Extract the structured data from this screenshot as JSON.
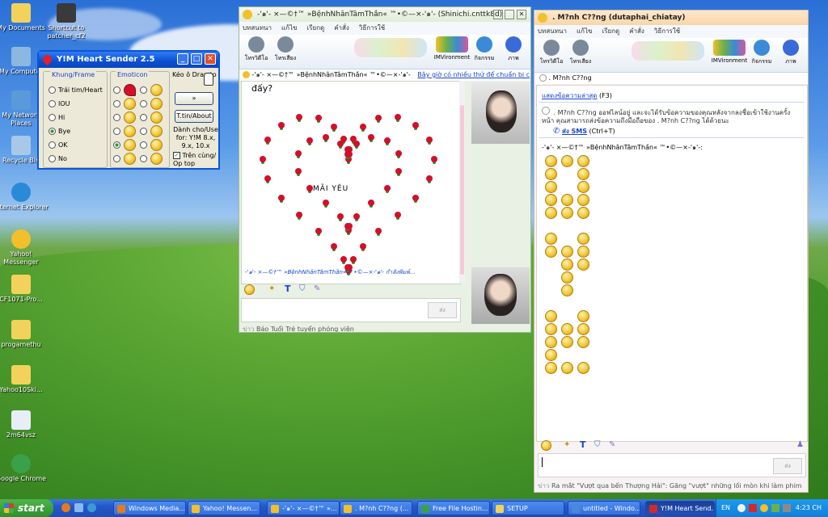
{
  "desktop": {
    "icons": [
      {
        "label": "My Documents",
        "icon": "folder-icon"
      },
      {
        "label": "Shortcut to patcher_cf2",
        "icon": "app-shortcut-icon"
      },
      {
        "label": "My Computer",
        "icon": "computer-icon"
      },
      {
        "label": "My Network Places",
        "icon": "network-icon"
      },
      {
        "label": "Recycle Bin",
        "icon": "recycle-bin-icon"
      },
      {
        "label": "Internet Explorer",
        "icon": "internet-explorer-icon"
      },
      {
        "label": "Yahoo! Messenger",
        "icon": "yahoo-messenger-icon"
      },
      {
        "label": "CF1071-Pro...",
        "icon": "folder-icon"
      },
      {
        "label": "progamethu",
        "icon": "folder-icon"
      },
      {
        "label": "Yahoo10Ski...",
        "icon": "folder-icon"
      },
      {
        "label": "2m64vsz",
        "icon": "file-icon"
      },
      {
        "label": "Google Chrome",
        "icon": "chrome-icon"
      }
    ]
  },
  "heart_sender": {
    "title": "Y!M Heart Sender 2.5",
    "frame_group": "Khung/Frame",
    "frame_options": [
      "Trái tim/Heart",
      "IOU",
      "Hi",
      "Bye",
      "OK",
      "No"
    ],
    "frame_selected": "Bye",
    "emoticon_group": "Emoticon",
    "drag_hint": "Kéo ô Drap to",
    "send_button": "»",
    "about_button": "T.tin/About",
    "compat_text": "Dành cho/Use for: Y!M 8.x, 9.x, 10.x",
    "ontop_label": "Trên cùng/ Op top",
    "ontop_checked": true
  },
  "chat1": {
    "title": "-'๑'- ×—©†™ »BệnhNhânTâmThần« ™•©—×-'๑'- (Shinichi.cnttk8d)",
    "menu": [
      "บทสนทนา",
      "แก้ไข",
      "เรียกดู",
      "คำสั่ง",
      "วิธีการใช้"
    ],
    "toolbar": [
      "โทรวิดีโอ",
      "โทรเสียง",
      "IMVironment",
      "กิจกรรม",
      "ภาพ"
    ],
    "header_name": "-'๑'- ×—©†™ »BệnhNhânTâmThần« ™•©—×-'๑'-",
    "header_status": "Bây giờ có nhiều thứ để chuẩn bị c",
    "first_line": "đấy?",
    "heart_text": "MÃI  YÊU",
    "typing_line": "-'๑'- ×—©†™ »BệnhNhânTâmThần« ™•©—×-'๑'- กำลังพิมพ์...",
    "send_label": "ส่ง",
    "footer": "Báo Tuổi Trẻ tuyển phóng viên"
  },
  "chat2": {
    "title": ". M?nh C??ng (dutaphai_chiatay)",
    "menu": [
      "บทสนทนา",
      "แก้ไข",
      "เรียกดู",
      "คำสั่ง",
      "วิธีการใช้"
    ],
    "toolbar": [
      "โทรวิดีโอ",
      "โทรเสียง",
      "IMVironment",
      "กิจกรรม",
      "ภาพ"
    ],
    "contact_name": ". M?nh C??ng",
    "show_recent": "แสดงข้อความล่าสุด",
    "show_recent_key": "(F3)",
    "notice": ". M?nh C??ng ออฟไลน์อยู่ และจะได้รับข้อความของคุณหลังจากลงชื่อเข้าใช้งานครั้งหน้า คุณสามารถส่งข้อความถึงมือถือของ . M?nh C??ng ได้ด้วยนะ",
    "sms_link": "ส่ง SMS",
    "sms_key": "(Ctrl+T)",
    "sender_line": "-'๑'- ×—©†™ »BệnhNhânTâmThần« ™•©—×-'๑'-:",
    "send_label": "ส่ง",
    "footer": "Ra mắt \"Vượt qua bến Thượng Hải\": Găng \"vượt\" những lối mòn khi làm phim"
  },
  "taskbar": {
    "start_label": "start",
    "tasks": [
      {
        "label": "Windows Media...",
        "color": "#e87a1c"
      },
      {
        "label": "Yahoo! Messen...",
        "color": "#f2c02a"
      },
      {
        "label": "-'๑'- ×—©†™ »...",
        "color": "#f2c02a"
      },
      {
        "label": ". M?nh C??ng (...",
        "color": "#f2c02a"
      },
      {
        "label": "Free File Hostin...",
        "color": "#3aa04a"
      },
      {
        "label": "SETUP",
        "color": "#f2d25a"
      },
      {
        "label": "untitled - Windo...",
        "color": "#4a8ad8"
      },
      {
        "label": "Y!M Heart Send...",
        "color": "#d22a2a"
      }
    ],
    "language": "EN",
    "clock": "4:23 CH"
  },
  "colors": {
    "xp_blue": "#0a4fd1",
    "heart_rose": "#d2102a",
    "link_blue": "#1a44c8"
  }
}
